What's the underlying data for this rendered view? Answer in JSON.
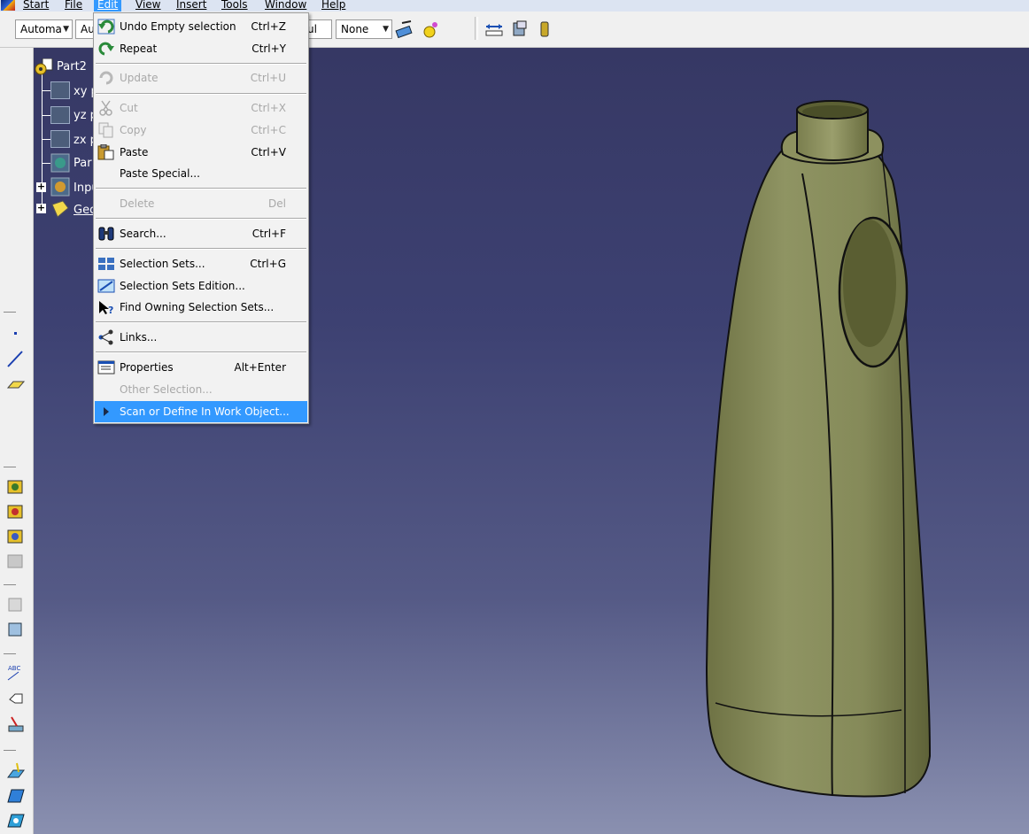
{
  "menubar": {
    "items": [
      {
        "label": "Start"
      },
      {
        "label": "File"
      },
      {
        "label": "Edit"
      },
      {
        "label": "View"
      },
      {
        "label": "Insert"
      },
      {
        "label": "Tools"
      },
      {
        "label": "Window"
      },
      {
        "label": "Help"
      }
    ]
  },
  "toolbar": {
    "combo1": "Automa",
    "combo2": "Au",
    "combo3": "ul",
    "combo4": "None"
  },
  "tree": {
    "root": "Part2",
    "xy": "xy p",
    "yz": "yz p",
    "zx": "zx p",
    "partbody": "Par",
    "inputs": "Inpu",
    "geo": "Geo"
  },
  "edit_menu": {
    "items": [
      {
        "label": "Undo Empty selection",
        "shortcut": "Ctrl+Z",
        "enabled": true,
        "icon": "undo-icon"
      },
      {
        "label": "Repeat",
        "shortcut": "Ctrl+Y",
        "enabled": true,
        "icon": "repeat-icon"
      },
      {
        "label": "Update",
        "shortcut": "Ctrl+U",
        "enabled": false,
        "icon": "update-icon"
      },
      {
        "label": "Cut",
        "shortcut": "Ctrl+X",
        "enabled": false,
        "icon": "cut-icon"
      },
      {
        "label": "Copy",
        "shortcut": "Ctrl+C",
        "enabled": false,
        "icon": "copy-icon"
      },
      {
        "label": "Paste",
        "shortcut": "Ctrl+V",
        "enabled": true,
        "icon": "paste-icon"
      },
      {
        "label": "Paste Special...",
        "shortcut": "",
        "enabled": true,
        "icon": ""
      },
      {
        "label": "Delete",
        "shortcut": "Del",
        "enabled": false,
        "icon": ""
      },
      {
        "label": "Search...",
        "shortcut": "Ctrl+F",
        "enabled": true,
        "icon": "binoculars-icon"
      },
      {
        "label": "Selection Sets...",
        "shortcut": "Ctrl+G",
        "enabled": true,
        "icon": "selection-sets-icon"
      },
      {
        "label": "Selection Sets Edition...",
        "shortcut": "",
        "enabled": true,
        "icon": "selection-sets-edition-icon"
      },
      {
        "label": "Find Owning Selection Sets...",
        "shortcut": "",
        "enabled": true,
        "icon": "find-owning-icon"
      },
      {
        "label": "Links...",
        "shortcut": "",
        "enabled": true,
        "icon": "links-icon"
      },
      {
        "label": "Properties",
        "shortcut": "Alt+Enter",
        "enabled": true,
        "icon": "properties-icon"
      },
      {
        "label": "Other Selection...",
        "shortcut": "",
        "enabled": false,
        "icon": ""
      },
      {
        "label": "Scan or Define In Work Object...",
        "shortcut": "",
        "enabled": true,
        "icon": "arrow-right-icon"
      }
    ]
  },
  "colors": {
    "menu_highlight": "#3399ff",
    "part_surface": "#8a8e5e",
    "viewport_top": "#363864",
    "viewport_bottom": "#8a90b0"
  }
}
